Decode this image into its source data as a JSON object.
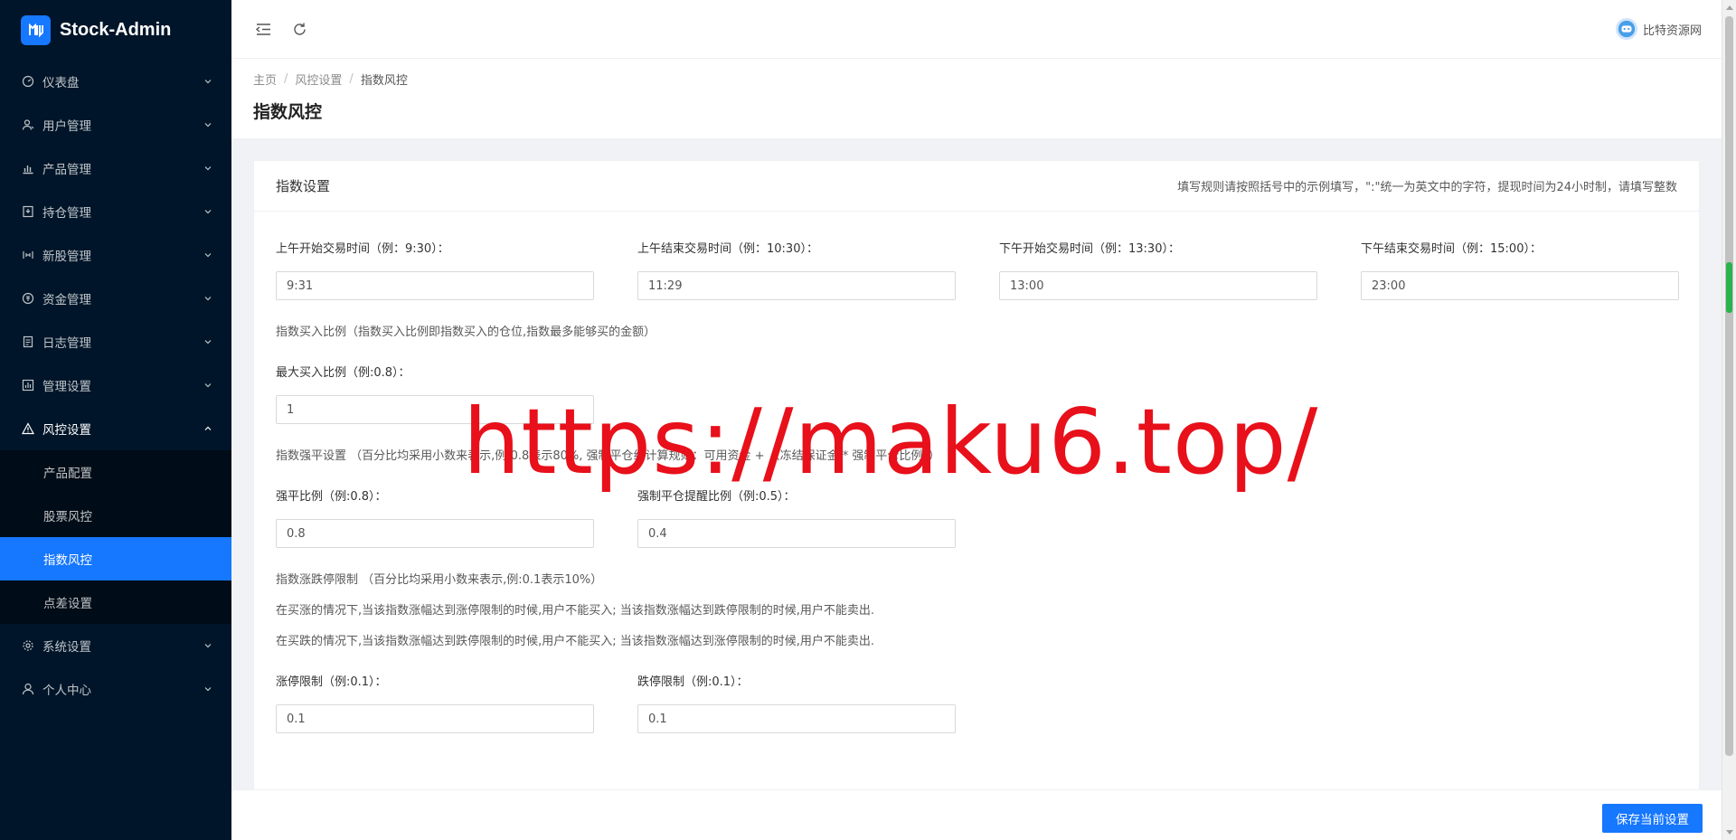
{
  "app": {
    "title": "Stock-Admin",
    "brand_color": "#1677ff",
    "sidebar_bg": "#001529"
  },
  "sidebar": {
    "items": [
      {
        "label": "仪表盘",
        "icon": "dashboard-icon"
      },
      {
        "label": "用户管理",
        "icon": "user-manage-icon"
      },
      {
        "label": "产品管理",
        "icon": "bar-chart-icon"
      },
      {
        "label": "持仓管理",
        "icon": "holdings-icon"
      },
      {
        "label": "新股管理",
        "icon": "ipo-icon"
      },
      {
        "label": "资金管理",
        "icon": "money-icon"
      },
      {
        "label": "日志管理",
        "icon": "log-icon"
      },
      {
        "label": "管理设置",
        "icon": "admin-settings-icon"
      },
      {
        "label": "风控设置",
        "icon": "warning-icon",
        "expanded": true
      },
      {
        "label": "系统设置",
        "icon": "gear-icon"
      },
      {
        "label": "个人中心",
        "icon": "user-icon"
      }
    ],
    "risk_sub": [
      {
        "label": "产品配置"
      },
      {
        "label": "股票风控"
      },
      {
        "label": "指数风控",
        "active": true
      },
      {
        "label": "点差设置"
      }
    ]
  },
  "header": {
    "user_name": "比特资源网"
  },
  "breadcrumb": [
    "主页",
    "风控设置",
    "指数风控"
  ],
  "page_title": "指数风控",
  "card": {
    "title": "指数设置",
    "extra": "填写规则请按照括号中的示例填写，\":\"统一为英文中的字符，提现时间为24小时制，请填写整数"
  },
  "trading_times": [
    {
      "label": "上午开始交易时间（例：9:30）：",
      "value": "9:31"
    },
    {
      "label": "上午结束交易时间（例：10:30）：",
      "value": "11:29"
    },
    {
      "label": "下午开始交易时间（例：13:30）：",
      "value": "13:00"
    },
    {
      "label": "下午结束交易时间（例：15:00）：",
      "value": "23:00"
    }
  ],
  "buy_ratio": {
    "note": "指数买入比例（指数买入比例即指数买入的仓位,指数最多能够买的金额）",
    "label": "最大买入比例（例:0.8）：",
    "value": "1"
  },
  "force_close": {
    "note": "指数强平设置 （百分比均采用小数来表示,例:0.8表示80%, 强制平仓线计算规则：可用资金 + （冻结保证金 * 强制平仓比例））",
    "ratio_label": "强平比例（例:0.8）：",
    "ratio_value": "0.8",
    "remind_label": "强制平仓提醒比例（例:0.5）：",
    "remind_value": "0.4"
  },
  "limit": {
    "note": "指数涨跌停限制 （百分比均采用小数来表示,例:0.1表示10%）",
    "rule_up": "在买涨的情况下,当该指数涨幅达到涨停限制的时候,用户不能买入; 当该指数涨幅达到跌停限制的时候,用户不能卖出.",
    "rule_down": "在买跌的情况下,当该指数涨幅达到跌停限制的时候,用户不能买入; 当该指数涨幅达到涨停限制的时候,用户不能卖出.",
    "up_label": "涨停限制（例:0.1）：",
    "up_value": "0.1",
    "down_label": "跌停限制（例:0.1）：",
    "down_value": "0.1"
  },
  "save_label": "保存当前设置",
  "watermark": "https://maku6.top/"
}
